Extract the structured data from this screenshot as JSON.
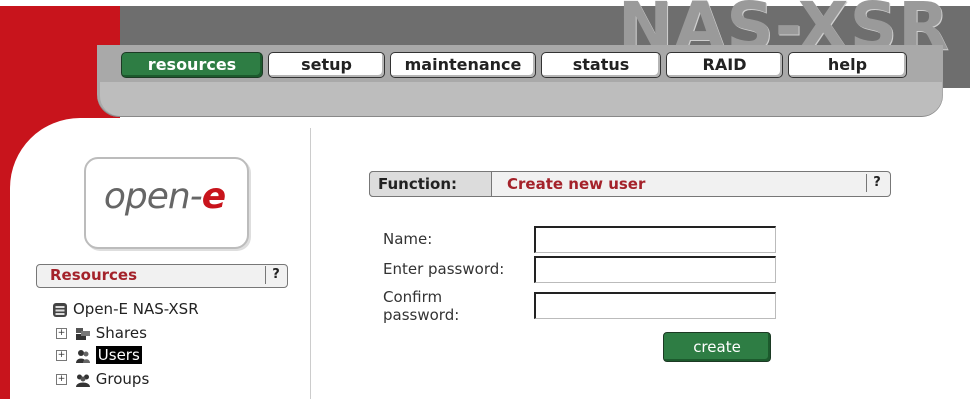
{
  "app": {
    "brand": "NAS-XSR"
  },
  "tabs": [
    {
      "label": "resources",
      "active": true
    },
    {
      "label": "setup",
      "active": false
    },
    {
      "label": "maintenance",
      "active": false
    },
    {
      "label": "status",
      "active": false
    },
    {
      "label": "RAID",
      "active": false
    },
    {
      "label": "help",
      "active": false
    }
  ],
  "logo": {
    "prefix": "open-",
    "accent": "e"
  },
  "resources": {
    "title": "Resources",
    "help": "?",
    "tree": {
      "root": "Open-E NAS-XSR",
      "items": [
        {
          "label": "Shares",
          "expander": "+"
        },
        {
          "label": "Users",
          "expander": "+",
          "selected": true
        },
        {
          "label": "Groups",
          "expander": "+"
        }
      ]
    }
  },
  "function_bar": {
    "label": "Function:",
    "value": "Create new user",
    "help": "?"
  },
  "form": {
    "name_label": "Name:",
    "password_label": "Enter password:",
    "confirm_label_line1": "Confirm",
    "confirm_label_line2": "password:",
    "name_value": "",
    "password_value": "",
    "confirm_value": "",
    "submit_label": "create"
  },
  "colors": {
    "accent_red": "#c8141c",
    "active_green": "#2e7d44",
    "label_red": "#a4222a"
  }
}
